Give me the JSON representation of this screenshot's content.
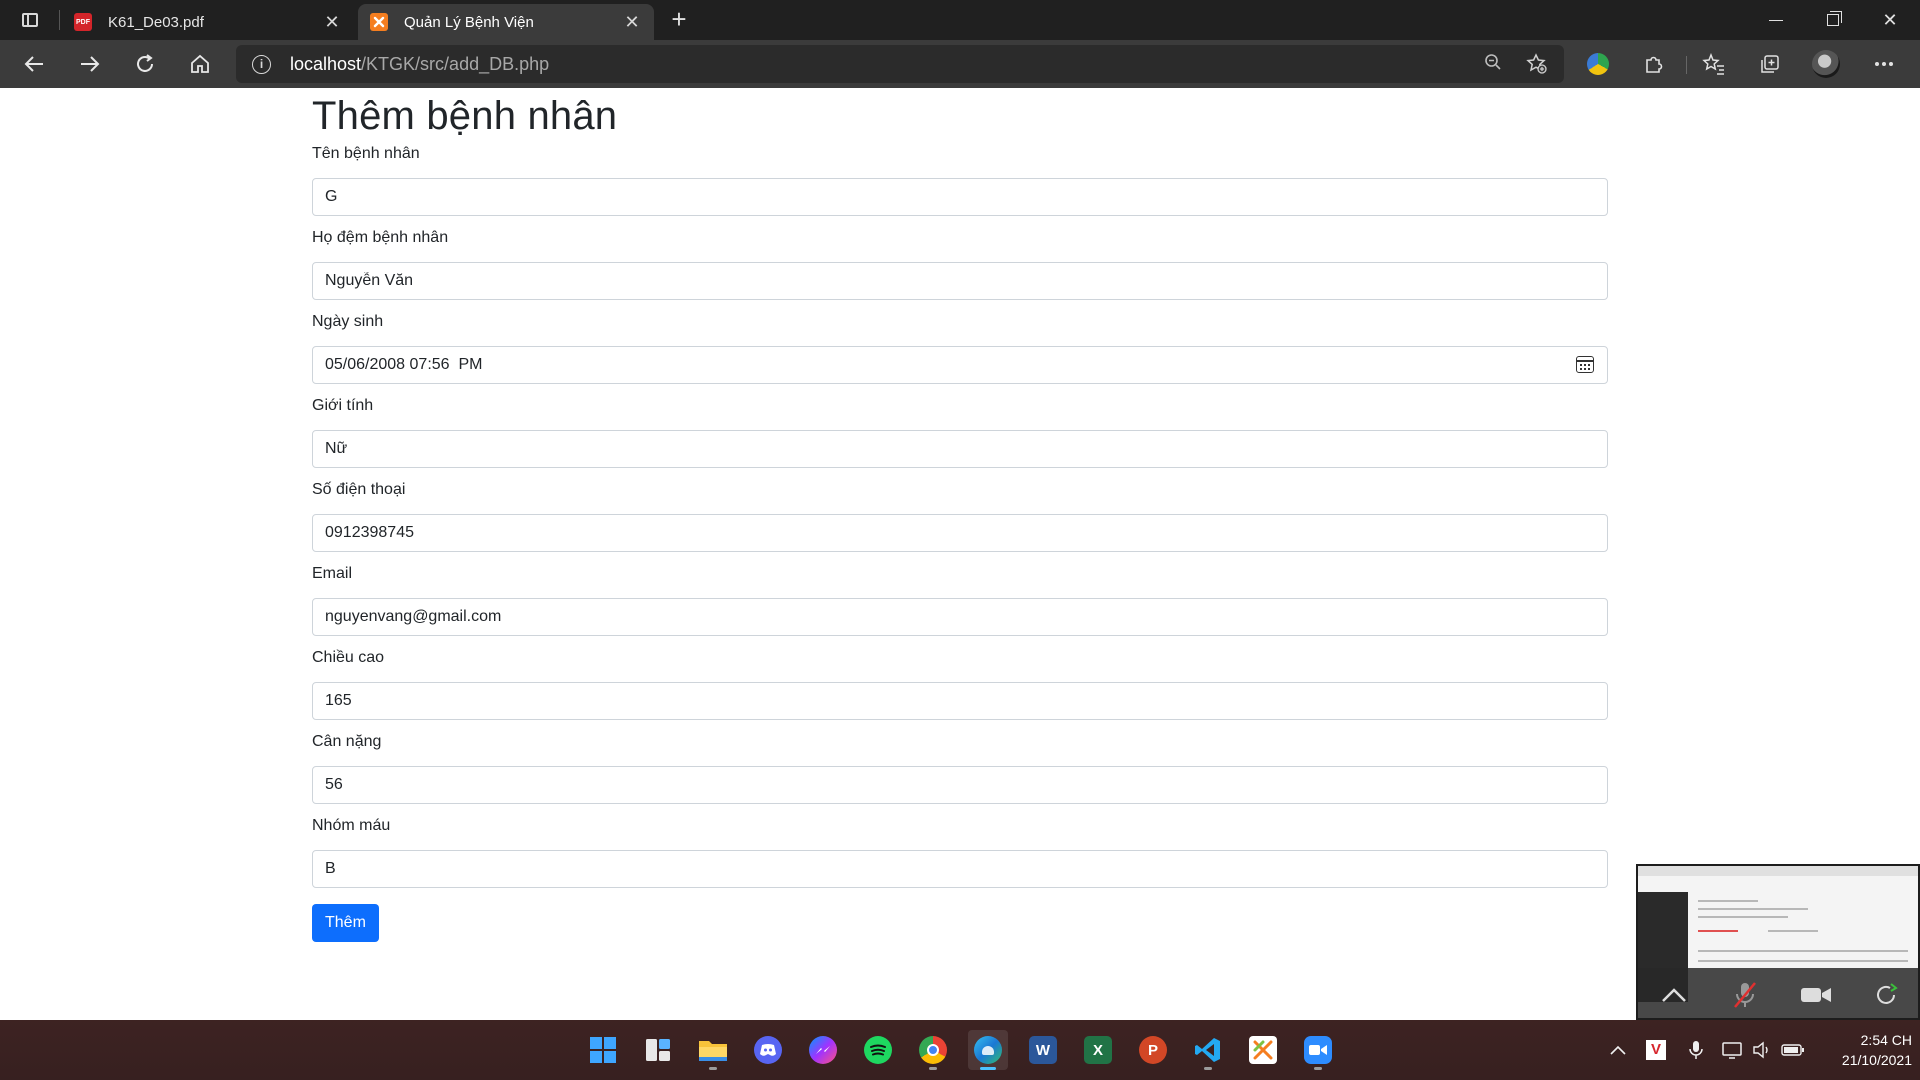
{
  "browser": {
    "tabs": [
      {
        "title": "K61_De03.pdf",
        "favicon": "pdf-icon",
        "favicon_text": "PDF",
        "active": false
      },
      {
        "title": "Quản Lý Bệnh Viện",
        "favicon": "xampp-icon",
        "active": true
      }
    ],
    "url_host": "localhost",
    "url_path": "/KTGK/src/add_DB.php"
  },
  "page": {
    "title": "Thêm bệnh nhân",
    "fields": [
      {
        "label": "Tên bệnh nhân",
        "value": "G",
        "type": "text"
      },
      {
        "label": "Họ đệm bệnh nhân",
        "value": "Nguyễn Văn",
        "type": "text"
      },
      {
        "label": "Ngày sinh",
        "value": "05/06/2008 07:56  PM",
        "type": "datetime"
      },
      {
        "label": "Giới tính",
        "value": "Nữ",
        "type": "text"
      },
      {
        "label": "Số điện thoại",
        "value": "0912398745",
        "type": "text"
      },
      {
        "label": "Email",
        "value": "nguyenvang@gmail.com",
        "type": "text"
      },
      {
        "label": "Chiều cao",
        "value": "165",
        "type": "text"
      },
      {
        "label": "Cân nặng",
        "value": "56",
        "type": "text"
      },
      {
        "label": "Nhóm máu",
        "value": "B",
        "type": "text"
      }
    ],
    "submit_label": "Thêm",
    "accent_color": "#0d6efd"
  },
  "taskbar": {
    "apps": [
      "windows-start-icon",
      "task-view-icon",
      "file-explorer-icon",
      "discord-icon",
      "messenger-icon",
      "spotify-icon",
      "chrome-icon",
      "edge-icon",
      "word-icon",
      "excel-icon",
      "powerpoint-icon",
      "vscode-icon",
      "xampp-icon",
      "zoom-icon"
    ],
    "time": "2:54 CH",
    "date": "21/10/2021"
  }
}
